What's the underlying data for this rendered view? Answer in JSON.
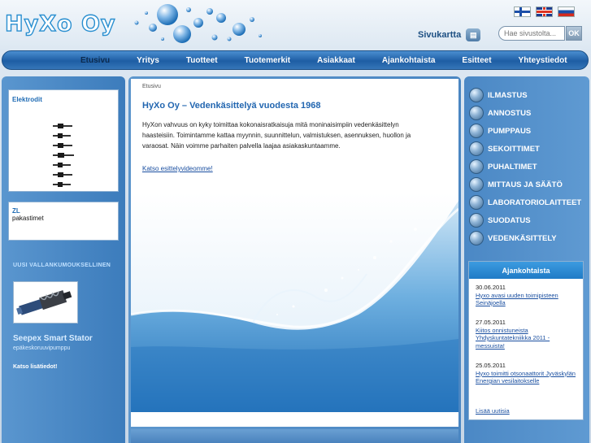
{
  "header": {
    "logo": "HyXo Oy",
    "sitemap_label": "Sivukartta",
    "search_placeholder": "Hae sivustolta...",
    "search_button": "OK"
  },
  "nav": {
    "items": [
      {
        "label": "Etusivu",
        "active": true
      },
      {
        "label": "Yritys"
      },
      {
        "label": "Tuotteet"
      },
      {
        "label": "Tuotemerkit"
      },
      {
        "label": "Asiakkaat"
      },
      {
        "label": "Ajankohtaista"
      },
      {
        "label": "Esitteet"
      },
      {
        "label": "Yhteystiedot"
      }
    ]
  },
  "left": {
    "elektrodit_title": "Elektrodit",
    "zl_title": "ZL",
    "zl_text": "pakastimet",
    "promo_head": "UUSI VALLANKUMOUKSELLINEN",
    "promo_title": "Seepex Smart Stator",
    "promo_sub": "epäkeskoruuvipumppu",
    "promo_link": "Katso lisätiedot!"
  },
  "main": {
    "breadcrumb": "Etusivu",
    "title": "HyXo Oy – Vedenkäsittelyä vuodesta 1968",
    "intro": "HyXon vahvuus on kyky toimittaa kokonaisratkaisuja mitä moninaisimpiin vedenkäsittelyn haasteisiin. Toimintamme kattaa myynnin, suunnittelun, valmistuksen, asennuksen, huollon ja varaosat. Näin voimme parhaiten palvella laajaa asiakaskuntaamme.",
    "video_link": "Katso esittelyvideomme!"
  },
  "right": {
    "categories": [
      "ILMASTUS",
      "ANNOSTUS",
      "PUMPPAUS",
      "SEKOITTIMET",
      "PUHALTIMET",
      "MITTAUS JA SÄÄTÖ",
      "LABORATORIOLAITTEET",
      "SUODATUS",
      "VEDENKÄSITTELY"
    ],
    "news_title": "Ajankohtaista",
    "news": [
      {
        "date": "30.06.2011",
        "text": "Hyxo avasi uuden toimipisteen Seinäjoella"
      },
      {
        "date": "27.05.2011",
        "text": "Kiitos onnistuneista Yhdyskuntatekniikka 2011 -messuista!"
      },
      {
        "date": "25.05.2011",
        "text": "Hyxo toimitti otsonaattorit Jyväskylän Energian vesilaitokselle"
      }
    ],
    "news_more": "Lisää uutisia"
  }
}
